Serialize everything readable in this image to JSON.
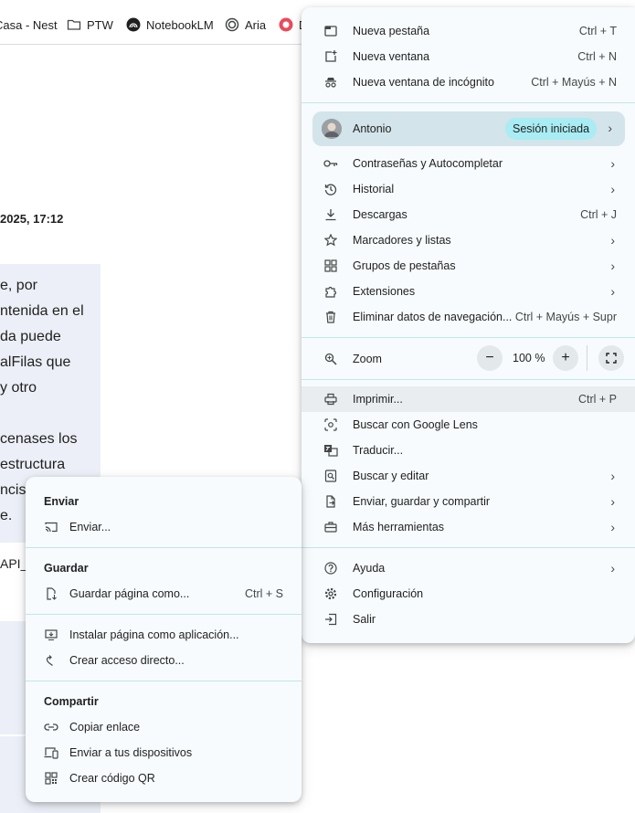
{
  "bookmarks": {
    "items": [
      {
        "label": "Casa - Nest",
        "icon": "home-icon"
      },
      {
        "label": "PTW",
        "icon": "folder-icon"
      },
      {
        "label": "NotebookLM",
        "icon": "notebooklm-icon"
      },
      {
        "label": "Aria",
        "icon": "aria-icon"
      },
      {
        "label": "D",
        "icon": "bookmark-favicon"
      }
    ]
  },
  "page": {
    "timestamp": "2025, 17:12",
    "message_lines": [
      "e, por",
      "ntenida en el",
      "da puede",
      "alFilas que",
      "y otro",
      "",
      "cenases los",
      "estructura",
      "ncis",
      "e."
    ],
    "code_fragment": "API_"
  },
  "main_menu": {
    "new_tab": {
      "label": "Nueva pestaña",
      "shortcut": "Ctrl + T"
    },
    "new_window": {
      "label": "Nueva ventana",
      "shortcut": "Ctrl + N"
    },
    "incognito": {
      "label": "Nueva ventana de incógnito",
      "shortcut": "Ctrl + Mayús + N"
    },
    "profile": {
      "name": "Antonio",
      "status": "Sesión iniciada"
    },
    "passwords": {
      "label": "Contraseñas y Autocompletar"
    },
    "history": {
      "label": "Historial"
    },
    "downloads": {
      "label": "Descargas",
      "shortcut": "Ctrl + J"
    },
    "bookmarks": {
      "label": "Marcadores y listas"
    },
    "tab_groups": {
      "label": "Grupos de pestañas"
    },
    "extensions": {
      "label": "Extensiones"
    },
    "clear_data": {
      "label": "Eliminar datos de navegación...",
      "shortcut": "Ctrl + Mayús + Supr"
    },
    "zoom": {
      "label": "Zoom",
      "value": "100 %",
      "minus": "−",
      "plus": "+"
    },
    "print": {
      "label": "Imprimir...",
      "shortcut": "Ctrl + P"
    },
    "lens": {
      "label": "Buscar con Google Lens"
    },
    "translate": {
      "label": "Traducir..."
    },
    "find_edit": {
      "label": "Buscar y editar"
    },
    "cast_save_share": {
      "label": "Enviar, guardar y compartir"
    },
    "more_tools": {
      "label": "Más herramientas"
    },
    "help": {
      "label": "Ayuda"
    },
    "settings": {
      "label": "Configuración"
    },
    "exit": {
      "label": "Salir"
    }
  },
  "sub_menu": {
    "send_title": "Enviar",
    "cast": {
      "label": "Enviar..."
    },
    "save_title": "Guardar",
    "save_page": {
      "label": "Guardar página como...",
      "shortcut": "Ctrl + S"
    },
    "install_app": {
      "label": "Instalar página como aplicación..."
    },
    "create_shortcut": {
      "label": "Crear acceso directo..."
    },
    "share_title": "Compartir",
    "copy_link": {
      "label": "Copiar enlace"
    },
    "send_devices": {
      "label": "Enviar a tus dispositivos"
    },
    "qr_code": {
      "label": "Crear código QR"
    }
  },
  "colors": {
    "menu_bg": "#f7fbfd",
    "profile_bg": "#d3e4ea",
    "badge_bg": "#a9ecf3",
    "highlight": "#e9edf0",
    "separator": "#bfe8ea"
  }
}
